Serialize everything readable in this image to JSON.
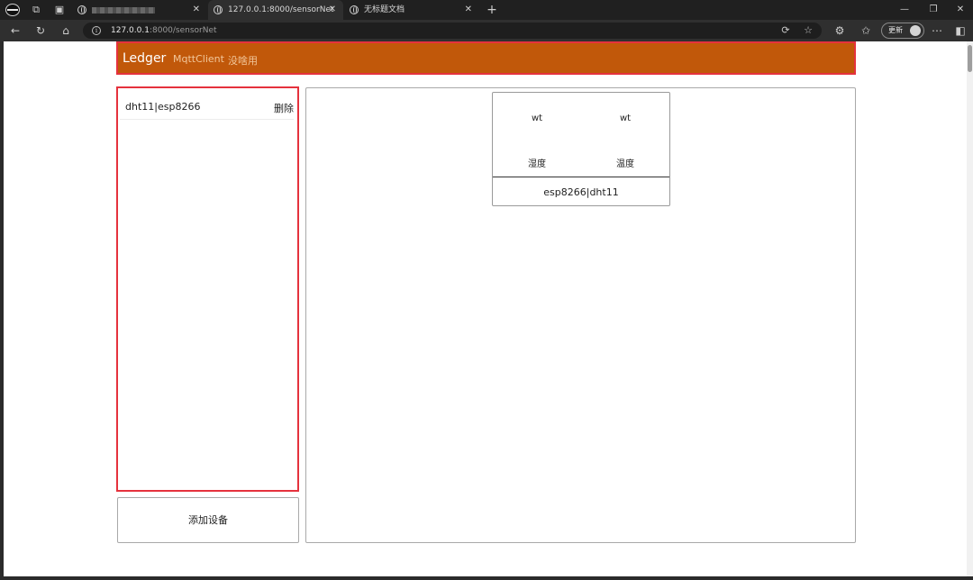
{
  "browser": {
    "tabs": [
      {
        "title": "",
        "blurred": true
      },
      {
        "title": "127.0.0.1:8000/sensorNet"
      },
      {
        "title": "无标题文档"
      }
    ],
    "new_tab_glyph": "+",
    "close_glyph": "✕",
    "window_controls": [
      "—",
      "❐",
      "✕"
    ],
    "url_host": "127.0.0.1",
    "url_rest": ":8000/sensorNet",
    "update_label": "更新",
    "icons": [
      "back-arrow-icon",
      "refresh-icon",
      "home-icon",
      "info-icon",
      "translate-icon",
      "star-icon",
      "extensions-icon",
      "favorites-icon",
      "more-icon",
      "sidebar-icon"
    ]
  },
  "navbar": {
    "brand": "Ledger",
    "links": [
      "MqttClient",
      "没啥用"
    ],
    "bg_color": "#c1580a",
    "highlight_color": "#e5323d"
  },
  "devices": [
    {
      "name": "dht11|esp8266",
      "delete_label": "删除"
    }
  ],
  "add_device_label": "添加设备",
  "sensor_card": {
    "values": [
      "wt",
      "wt"
    ],
    "labels": [
      "湿度",
      "温度"
    ],
    "title": "esp8266|dht11"
  }
}
